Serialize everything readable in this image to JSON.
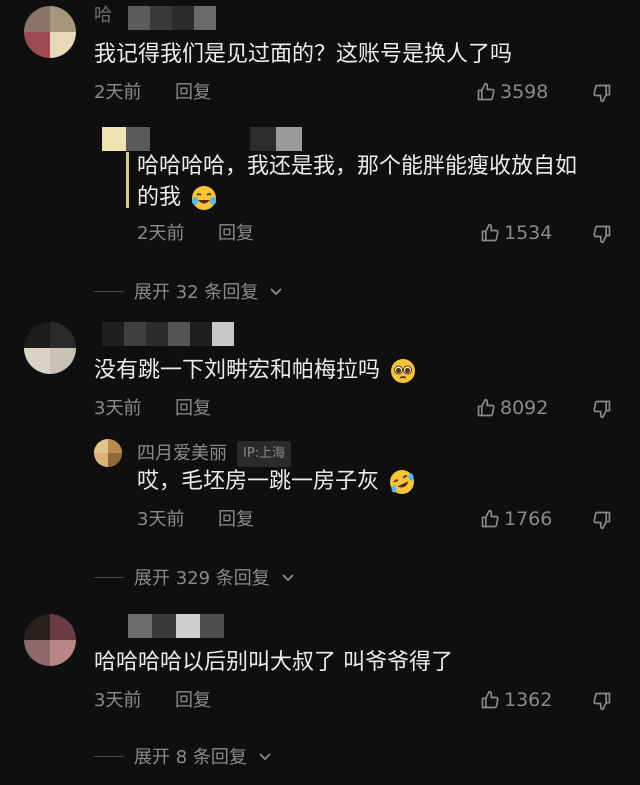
{
  "comments": [
    {
      "author_visible": "哈",
      "text": "我记得我们是见过面的？这账号是换人了吗",
      "time": "2天前",
      "reply_label": "回复",
      "likes": "3598",
      "replies": [
        {
          "text_line1": "哈哈哈哈，我还是我，那个能胖能瘦收放自如",
          "text_line2": "的我",
          "emoji": "crying-laughing",
          "time": "2天前",
          "reply_label": "回复",
          "likes": "1534"
        }
      ],
      "expand_label": "展开 32 条回复"
    },
    {
      "text": "没有跳一下刘畊宏和帕梅拉吗",
      "emoji": "pleading-face",
      "time": "3天前",
      "reply_label": "回复",
      "likes": "8092",
      "replies": [
        {
          "author": "四月爱美丽",
          "ip": "IP:上海",
          "text": "哎，毛坯房一跳一房子灰",
          "emoji": "rolling-laughing",
          "time": "3天前",
          "reply_label": "回复",
          "likes": "1766"
        }
      ],
      "expand_label": "展开 329 条回复"
    },
    {
      "text": "哈哈哈哈以后别叫大叔了 叫爷爷得了",
      "time": "3天前",
      "reply_label": "回复",
      "likes": "1362",
      "expand_label": "展开 8 条回复"
    }
  ],
  "colors": {
    "background": "#0f0f0f",
    "text": "#ececec",
    "muted": "#8a8a8a"
  },
  "icons": [
    "thumbs-up-icon",
    "thumbs-down-icon",
    "chevron-down-icon"
  ]
}
